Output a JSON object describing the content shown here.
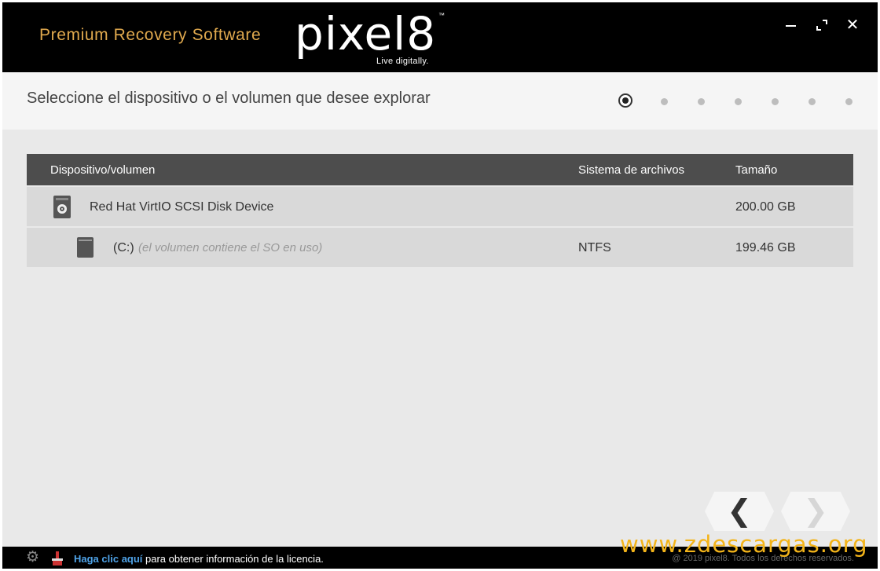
{
  "header": {
    "tagline": "Premium Recovery Software",
    "logo_text": "pixel8",
    "logo_tm": "™",
    "logo_sub": "Live digitally.",
    "window_controls": {
      "minimize_icon": "minimize-icon",
      "maximize_icon": "maximize-icon",
      "close_icon": "close-icon"
    }
  },
  "main": {
    "title": "Seleccione el dispositivo o el volumen que desee explorar",
    "steps_total": 7,
    "steps_active": 1
  },
  "table": {
    "columns": [
      "Dispositivo/volumen",
      "Sistema de archivos",
      "Tamaño"
    ],
    "rows": [
      {
        "name": "Red Hat VirtIO SCSI Disk Device",
        "note": "",
        "fs": "",
        "size": "200.00 GB",
        "icon": "disk-icon"
      },
      {
        "name": "(C:)",
        "note": "(el volumen contiene el SO en uso)",
        "fs": "NTFS",
        "size": "199.46 GB",
        "icon": "volume-icon"
      }
    ]
  },
  "nav": {
    "prev": "❮",
    "next": "❯"
  },
  "footer": {
    "link": "Haga clic aquí",
    "text": "para obtener información de la licencia.",
    "copyright": "@ 2019 pixel8. Todos los derechos reservados."
  },
  "watermark": "www.zdescargas.org",
  "colors": {
    "accent": "#e0a94e",
    "link": "#4fa3e8",
    "header_bg": "#000000",
    "table_header": "#4d4d4d"
  }
}
